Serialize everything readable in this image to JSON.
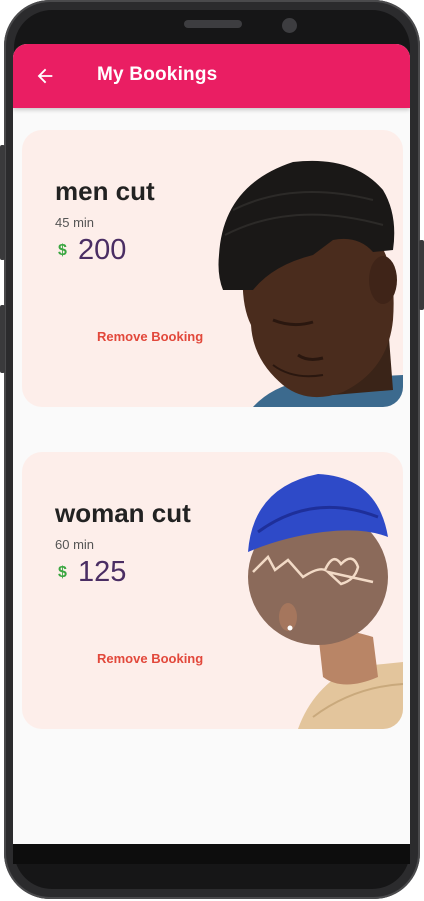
{
  "appbar": {
    "title": "My Bookings",
    "back_icon": "arrow-left-icon"
  },
  "bookings": [
    {
      "name": "men cut",
      "duration": "45 min",
      "currency_symbol": "$",
      "price": "200",
      "remove_label": "Remove Booking",
      "image": "man-haircut-photo"
    },
    {
      "name": "woman cut",
      "duration": "60 min",
      "currency_symbol": "$",
      "price": "125",
      "remove_label": "Remove Booking",
      "image": "woman-haircut-photo"
    }
  ],
  "colors": {
    "appbar": "#ea1e63",
    "card_bg": "#fdeeea",
    "price": "#4a2d63",
    "dollar": "#3aa641",
    "remove": "#e2483b"
  }
}
